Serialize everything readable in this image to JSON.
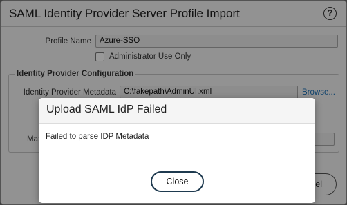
{
  "dialog": {
    "title": "SAML Identity Provider Server Profile Import",
    "help_icon": "?",
    "profile_name_label": "Profile Name",
    "profile_name_value": "Azure-SSO",
    "admin_use_only_label": "Administrator Use Only",
    "admin_use_only_checked": false,
    "idp_config_legend": "Identity Provider Configuration",
    "idp_metadata_label": "Identity Provider Metadata",
    "idp_metadata_value": "C:\\fakepath\\AdminUI.xml",
    "browse_label": "Browse...",
    "partial_label": "Max",
    "partial_button": "el"
  },
  "modal": {
    "title": "Upload SAML IdP Failed",
    "message": "Failed to parse IDP Metadata",
    "close_label": "Close"
  },
  "colors": {
    "link": "#1a6fb5",
    "close_border": "#1e3a4f"
  }
}
